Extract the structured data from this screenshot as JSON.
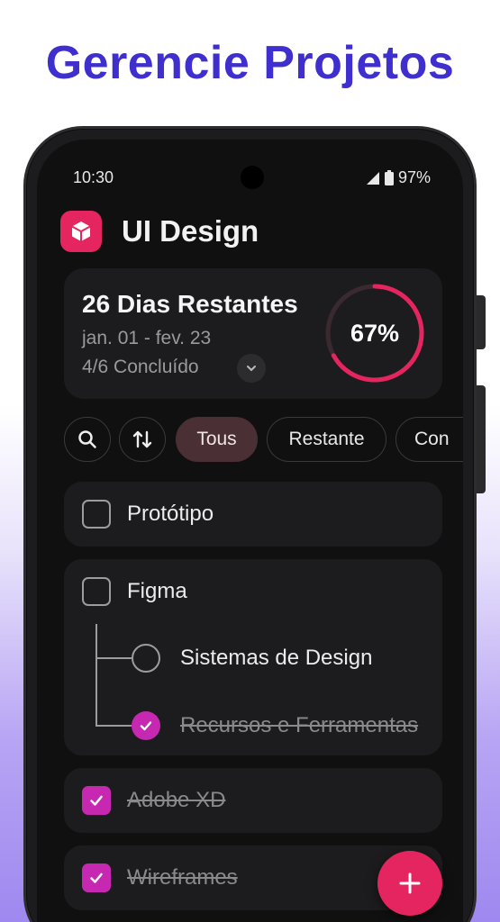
{
  "headline": "Gerencie Projetos",
  "status_bar": {
    "time": "10:30",
    "battery": "97%"
  },
  "app": {
    "title": "UI Design",
    "icon": "cube-icon"
  },
  "summary": {
    "days_left": "26 Dias Restantes",
    "date_range": "jan. 01 - fev. 23",
    "completed": "4/6 Concluído",
    "progress_label": "67%",
    "progress": 0.67
  },
  "filters": {
    "search_icon": "search-icon",
    "sort_icon": "sort-arrows-icon",
    "chips": [
      "Tous",
      "Restante",
      "Con"
    ]
  },
  "tasks": [
    {
      "label": "Protótipo",
      "done": false
    },
    {
      "label": "Figma",
      "done": false,
      "subtasks": [
        {
          "label": "Sistemas de Design",
          "done": false
        },
        {
          "label": "Recursos e Ferramentas",
          "done": true
        }
      ]
    },
    {
      "label": "Adobe XD",
      "done": true
    },
    {
      "label": "Wireframes",
      "done": true
    }
  ],
  "fab_icon": "plus-icon",
  "colors": {
    "accent": "#e5255f",
    "check": "#c628b1",
    "headline": "#3f2fcf"
  }
}
